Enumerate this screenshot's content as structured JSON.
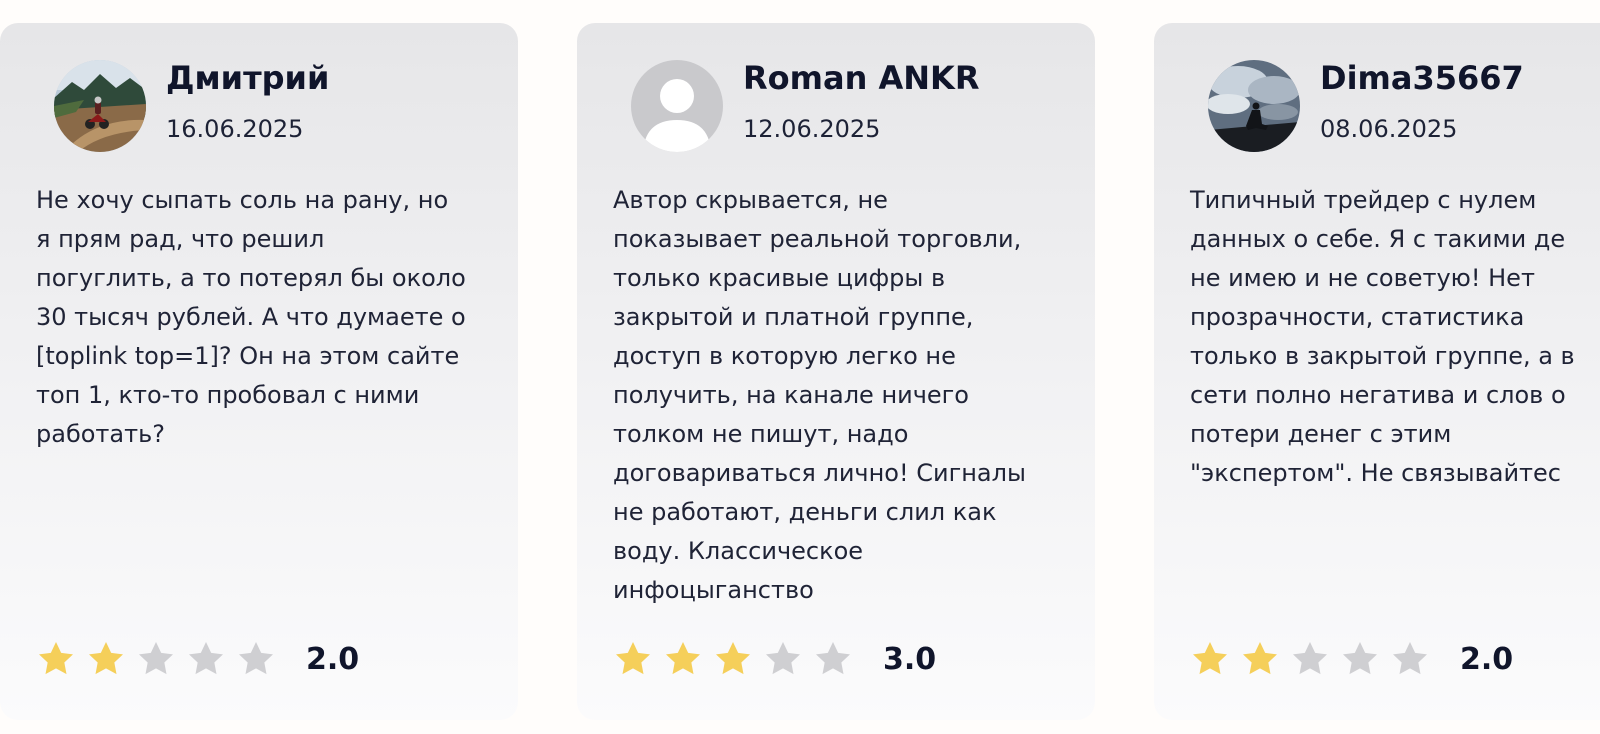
{
  "colors": {
    "star_filled": "#f5cf5a",
    "star_empty": "#cfcfd2",
    "text_dark": "#10152b",
    "card_top": "#e6e6e8",
    "card_bottom": "#fbfbfc"
  },
  "reviews": [
    {
      "author": "Дмитрий",
      "date": "16.06.2025",
      "avatar_icon": "motorcycle-photo-avatar",
      "text": "Не хочу сыпать соль на рану, но\nя прям рад, что решил\nпогуглить, а то потерял бы около\n30 тысяч рублей. А что думаете о\n[toplink top=1]? Он на этом сайте\nтоп 1, кто-то пробовал с ними\nработать?",
      "rating": 2,
      "rating_label": "2.0"
    },
    {
      "author": "Roman ANKR",
      "date": "12.06.2025",
      "avatar_icon": "default-user-avatar",
      "text": "Автор скрывается, не\nпоказывает реальной торговли,\nтолько красивые цифры в\nзакрытой и платной группе,\nдоступ в которую легко не\nполучить, на канале ничего\nтолком не пишут, надо\nдоговариваться лично! Сигналы\nне работают, деньги слил как\nводу. Классическое\nинфоцыганство",
      "rating": 3,
      "rating_label": "3.0"
    },
    {
      "author": "Dima35667",
      "date": "08.06.2025",
      "avatar_icon": "sky-silhouette-photo-avatar",
      "text": "Типичный трейдер с нулем\nданных о себе. Я с такими де\nне имею и не советую! Нет\nпрозрачности, статистика\nтолько в закрытой группе, а в\nсети полно негатива и слов о\nпотери денег с этим\n\"экспертом\". Не связывайтес",
      "rating": 2,
      "rating_label": "2.0"
    }
  ]
}
